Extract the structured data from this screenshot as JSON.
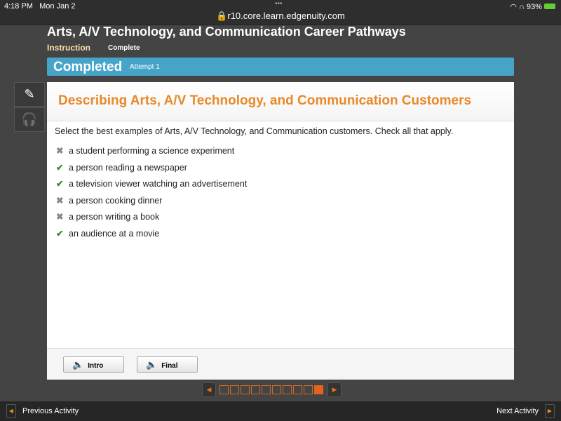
{
  "status": {
    "time": "4:18 PM",
    "date": "Mon Jan 2",
    "url": "r10.core.learn.edgenuity.com",
    "battery": "93%"
  },
  "header": {
    "title": "Arts, A/V Technology, and Communication Career Pathways",
    "tab_instruction": "Instruction",
    "tab_complete": "Complete"
  },
  "banner": {
    "label": "Completed",
    "attempt": "Attempt 1"
  },
  "tools": [
    {
      "icon": "pencil-icon"
    },
    {
      "icon": "headphones-icon"
    }
  ],
  "activity": {
    "heading": "Describing Arts, A/V Technology, and Communication Customers",
    "question": "Select the best examples of Arts, A/V Technology, and Communication customers. Check all that apply.",
    "options": [
      {
        "text": "a student performing a science experiment",
        "correct": false
      },
      {
        "text": "a person reading a newspaper",
        "correct": true
      },
      {
        "text": "a television viewer watching an advertisement",
        "correct": true
      },
      {
        "text": "a person cooking dinner",
        "correct": false
      },
      {
        "text": "a person writing a book",
        "correct": false
      },
      {
        "text": "an audience at a movie",
        "correct": true
      }
    ],
    "intro_label": "Intro",
    "final_label": "Final"
  },
  "pager": {
    "total": 10,
    "current": 10
  },
  "nav": {
    "previous": "Previous Activity",
    "next": "Next Activity"
  },
  "colors": {
    "accent": "#e8892a",
    "banner": "#47a4c9",
    "correct": "#3a8d2c"
  }
}
